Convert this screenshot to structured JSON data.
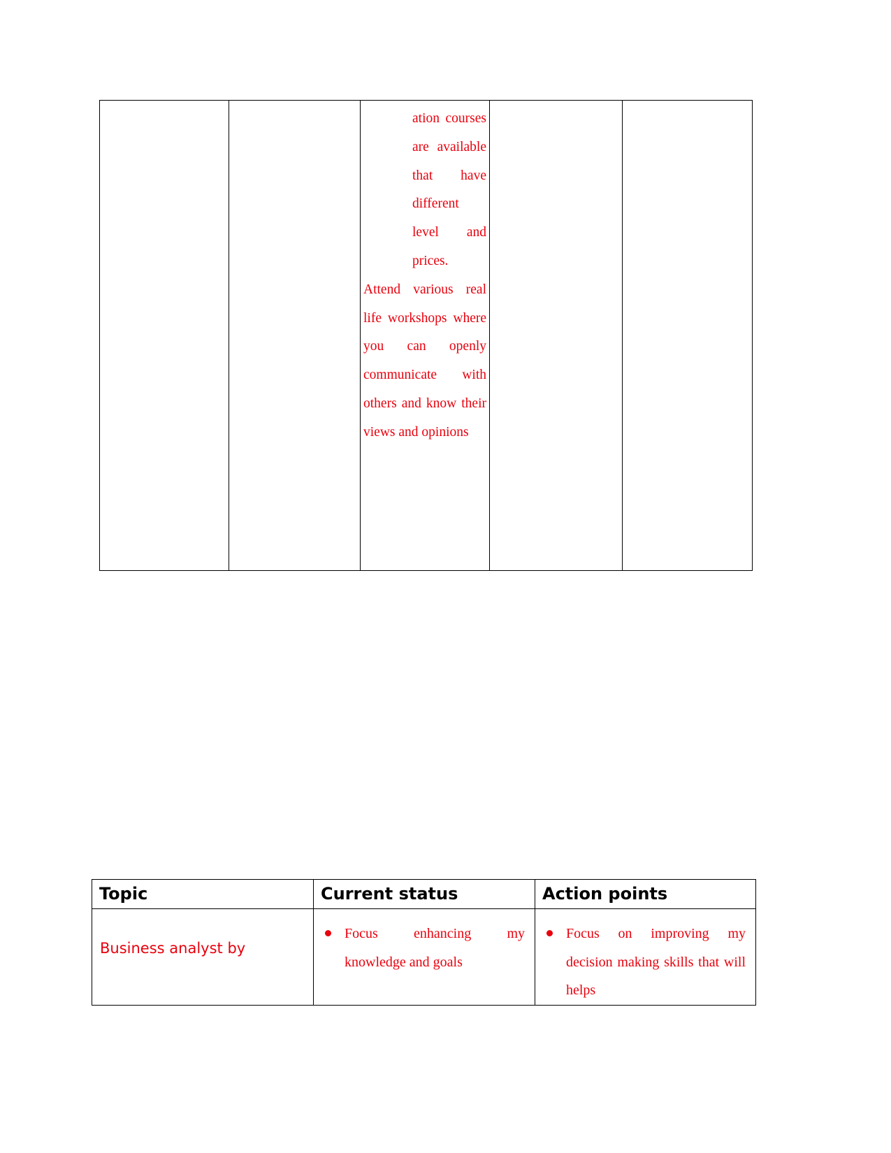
{
  "document": {
    "text_color": "#e8000d",
    "header_color": "#000000",
    "border_color": "#000000",
    "background": "#ffffff"
  },
  "top_table": {
    "name": "development-plan-table-continued",
    "columns": 5,
    "cells": {
      "col1": "",
      "col2": "",
      "col3": {
        "paragraph_1": "ation courses are available that have different level and prices.",
        "paragraph_2": "Attend various real life workshops where you can openly communicate with others and know their views and opinions"
      },
      "col4": "",
      "col5": ""
    }
  },
  "bottom_table": {
    "name": "reflection-table",
    "headers": [
      "Topic",
      "Current status",
      "Action points"
    ],
    "rows": [
      {
        "topic": "Business analyst by",
        "current_status": [
          "Focus enhancing my knowledge and goals"
        ],
        "action_points": [
          "Focus on improving my decision making skills that will helps"
        ]
      }
    ]
  }
}
